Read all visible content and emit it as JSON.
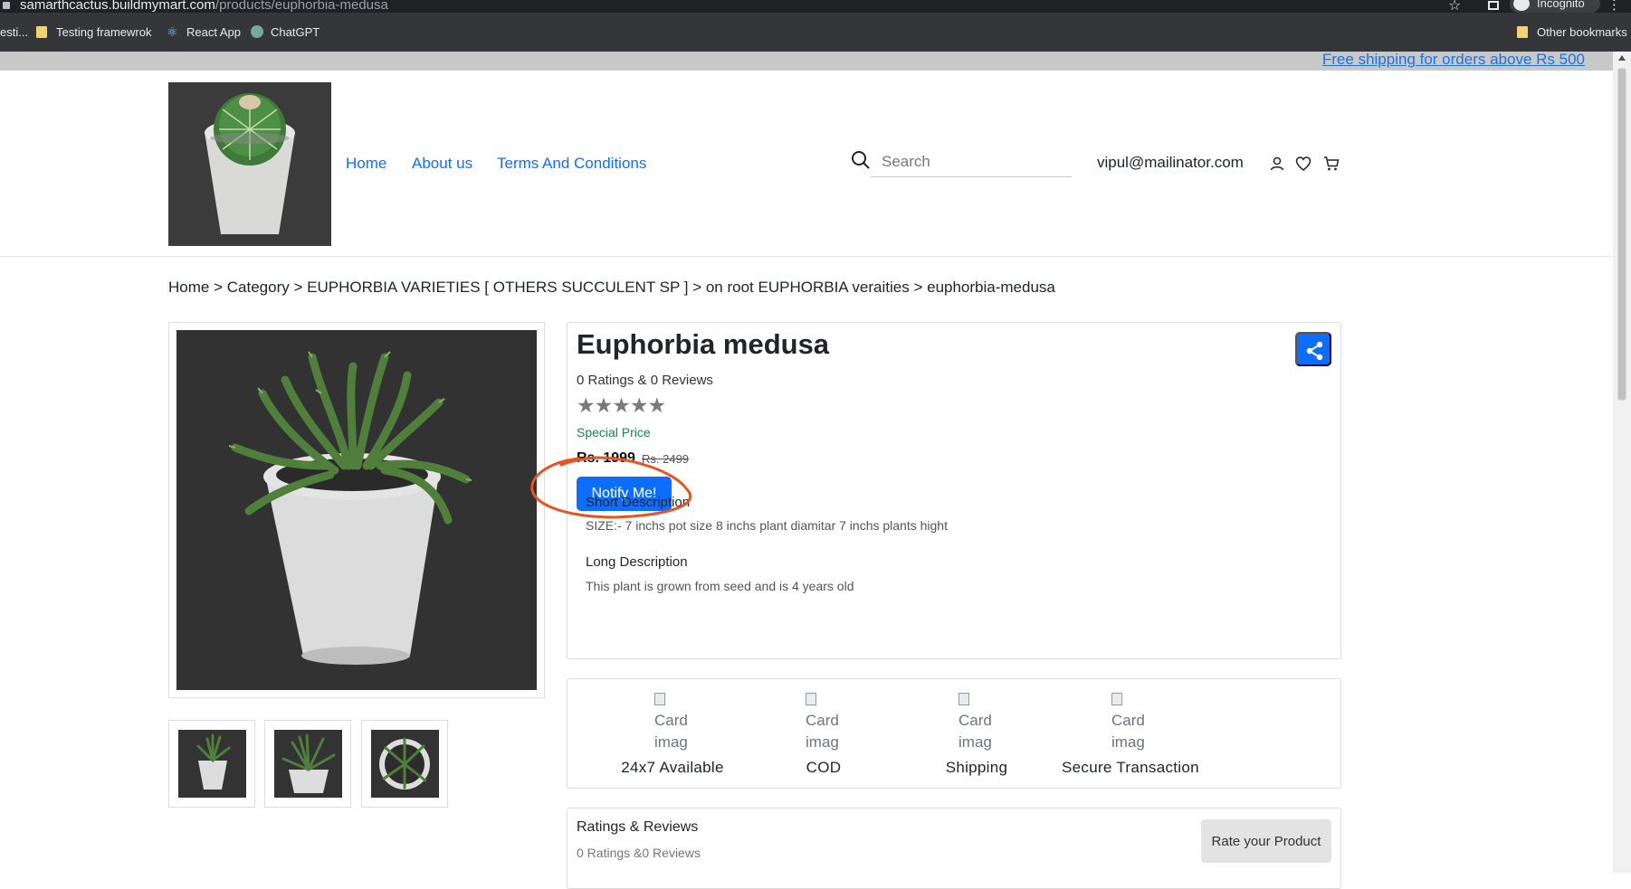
{
  "browser": {
    "url_host": "samarthcactus.buildmymart.com",
    "url_path": "/products/euphorbia-medusa",
    "incognito_label": "Incognito",
    "bookmarks": [
      {
        "label": "esti..."
      },
      {
        "label": "Testing framewrok"
      },
      {
        "label": "React App"
      },
      {
        "label": "ChatGPT"
      }
    ],
    "other_bookmarks": "Other bookmarks"
  },
  "announcement": {
    "text": "Free shipping for orders above Rs 500"
  },
  "header": {
    "nav": [
      {
        "label": "Home"
      },
      {
        "label": "About us"
      },
      {
        "label": "Terms And Conditions"
      }
    ],
    "search_placeholder": "Search",
    "user_email": "vipul@mailinator.com",
    "icons": [
      "user-icon",
      "heart-icon",
      "cart-icon"
    ]
  },
  "breadcrumb": [
    "Home",
    "Category",
    "EUPHORBIA VARIETIES [ OTHERS SUCCULENT SP ]",
    "on root EUPHORBIA veraities",
    "euphorbia-medusa"
  ],
  "breadcrumb_sep": ">",
  "product": {
    "title": "Euphorbia medusa",
    "ratings_text": "0 Ratings & 0 Reviews",
    "stars": "★★★★★",
    "special_price_label": "Special Price",
    "price": "Rs. 1999",
    "old_price": "Rs. 2499",
    "notify_label": "Notify Me!",
    "short_desc_title": "Short Description",
    "short_desc": "SIZE:- 7 inchs pot size 8 inchs plant diamitar 7 inchs plants hight",
    "long_desc_title": "Long Description",
    "long_desc": "This plant is grown from seed and is 4 years old"
  },
  "features": [
    {
      "alt": "Card imag",
      "label": "24x7 Available"
    },
    {
      "alt": "Card imag",
      "label": "COD"
    },
    {
      "alt": "Card imag",
      "label": "Shipping"
    },
    {
      "alt": "Card imag",
      "label": "Secure Transaction"
    }
  ],
  "reviews": {
    "title": "Ratings & Reviews",
    "subtitle": "0 Ratings &0 Reviews",
    "rate_button": "Rate your Product"
  },
  "colors": {
    "primary": "#0d6efd",
    "annotation": "#e8541f",
    "special_price": "#198754"
  }
}
